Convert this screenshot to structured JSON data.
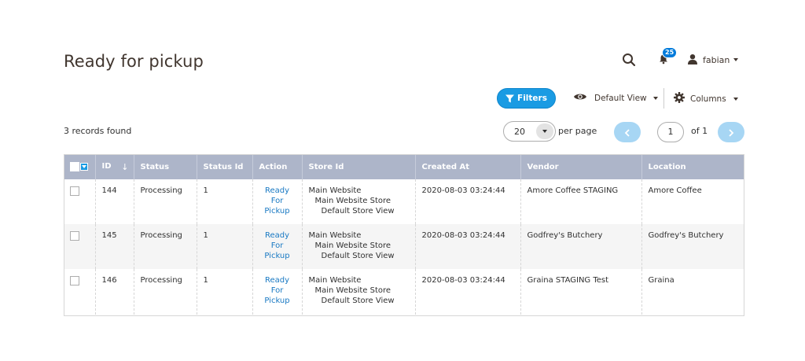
{
  "page": {
    "title": "Ready for pickup"
  },
  "header": {
    "search_icon": "search-icon",
    "notifications": {
      "count": "25"
    },
    "user": {
      "name": "fabian"
    }
  },
  "toolbar": {
    "filters_label": "Filters",
    "view_label": "Default View",
    "columns_label": "Columns"
  },
  "grid_info": {
    "records": "3 records found",
    "per_page_value": "20",
    "per_page_label": "per page",
    "current_page": "1",
    "of_total": "of 1"
  },
  "columns": [
    "ID",
    "Status",
    "Status Id",
    "Action",
    "Store Id",
    "Created At",
    "Vendor",
    "Location"
  ],
  "rows": [
    {
      "id": "144",
      "status": "Processing",
      "status_id": "1",
      "action": [
        "Ready",
        "For",
        "Pickup"
      ],
      "store": [
        "Main Website",
        "Main Website Store",
        "Default Store View"
      ],
      "created_at": "2020-08-03 03:24:44",
      "vendor": "Amore Coffee STAGING",
      "location": "Amore Coffee"
    },
    {
      "id": "145",
      "status": "Processing",
      "status_id": "1",
      "action": [
        "Ready",
        "For",
        "Pickup"
      ],
      "store": [
        "Main Website",
        "Main Website Store",
        "Default Store View"
      ],
      "created_at": "2020-08-03 03:24:44",
      "vendor": "Godfrey's Butchery",
      "location": "Godfrey's Butchery"
    },
    {
      "id": "146",
      "status": "Processing",
      "status_id": "1",
      "action": [
        "Ready",
        "For",
        "Pickup"
      ],
      "store": [
        "Main Website",
        "Main Website Store",
        "Default Store View"
      ],
      "created_at": "2020-08-03 03:24:44",
      "vendor": "Graina STAGING Test",
      "location": "Graina"
    }
  ],
  "colors": {
    "accent": "#1a9be3",
    "header_bg": "#adb5c9",
    "link": "#1979c3",
    "pager_btn": "#a7d6f4"
  }
}
